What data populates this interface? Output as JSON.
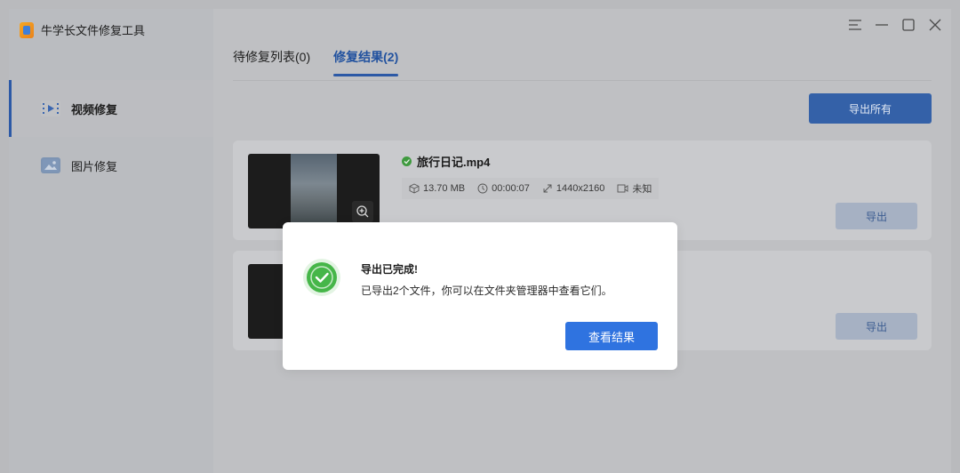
{
  "app": {
    "title": "牛学长文件修复工具"
  },
  "sidebar": {
    "items": [
      {
        "label": "视频修复",
        "icon": "video-repair-icon",
        "active": true
      },
      {
        "label": "图片修复",
        "icon": "image-repair-icon",
        "active": false
      }
    ]
  },
  "window_controls": [
    "menu-icon",
    "minimize-icon",
    "maximize-icon",
    "close-icon"
  ],
  "tabs": [
    {
      "label": "待修复列表(0)",
      "active": false
    },
    {
      "label": "修复结果(2)",
      "active": true
    }
  ],
  "toolbar": {
    "export_all_label": "导出所有"
  },
  "files": [
    {
      "name": "旅行日记.mp4",
      "size": "13.70 MB",
      "duration": "00:00:07",
      "resolution": "1440x2160",
      "audio": "未知",
      "export_label": "导出"
    },
    {
      "export_label": "导出"
    }
  ],
  "dialog": {
    "title": "导出已完成!",
    "message": "已导出2个文件，你可以在文件夹管理器中查看它们。",
    "button_label": "查看结果"
  },
  "colors": {
    "accent": "#2f73e0",
    "success": "#46b649",
    "overlay_bg": "#b9babd"
  }
}
